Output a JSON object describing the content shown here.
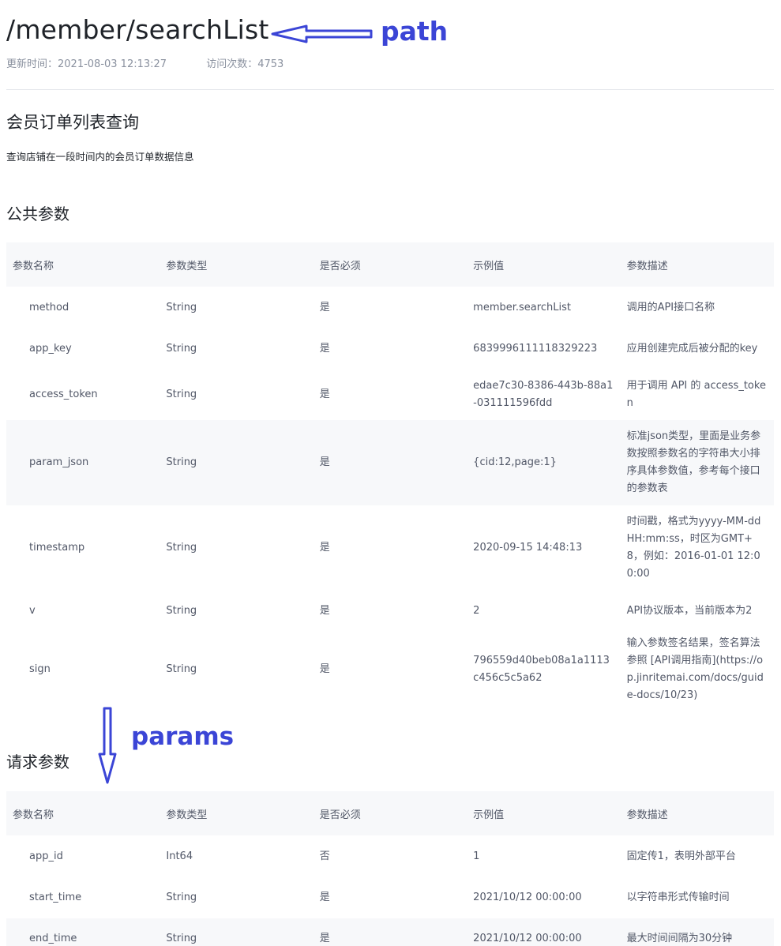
{
  "header": {
    "path": "/member/searchList",
    "updated_time": "更新时间：2021-08-03 12:13:27",
    "visit_count": "访问次数：4753"
  },
  "api": {
    "name": "会员订单列表查询",
    "description": "查询店铺在一段时间内的会员订单数据信息"
  },
  "annotations": {
    "path_label": "path",
    "params_label": "params",
    "color": "#3b45d6"
  },
  "columns": [
    "参数名称",
    "参数类型",
    "是否必须",
    "示例值",
    "参数描述"
  ],
  "public_params": {
    "title": "公共参数",
    "rows": [
      {
        "name": "method",
        "type": "String",
        "required": "是",
        "example": "member.searchList",
        "desc": "调用的API接口名称"
      },
      {
        "name": "app_key",
        "type": "String",
        "required": "是",
        "example": "6839996111118329223",
        "desc": "应用创建完成后被分配的key"
      },
      {
        "name": "access_token",
        "type": "String",
        "required": "是",
        "example": "edae7c30-8386-443b-88a1-031111596fdd",
        "desc": "用于调用 API 的 access_token"
      },
      {
        "name": "param_json",
        "type": "String",
        "required": "是",
        "example": "{cid:12,page:1}",
        "desc": "标准json类型，里面是业务参数按照参数名的字符串大小排序具体参数值，参考每个接口的参数表"
      },
      {
        "name": "timestamp",
        "type": "String",
        "required": "是",
        "example": "2020-09-15 14:48:13",
        "desc": "时间戳，格式为yyyy-MM-dd HH:mm:ss，时区为GMT+8，例如：2016-01-01 12:00:00"
      },
      {
        "name": "v",
        "type": "String",
        "required": "是",
        "example": "2",
        "desc": "API协议版本，当前版本为2"
      },
      {
        "name": "sign",
        "type": "String",
        "required": "是",
        "example": "796559d40beb08a1a1113c456c5c5a62",
        "desc": "输入参数签名结果，签名算法参照 [API调用指南](https://op.jinritemai.com/docs/guide-docs/10/23)"
      }
    ]
  },
  "request_params": {
    "title": "请求参数",
    "rows": [
      {
        "name": "app_id",
        "type": "Int64",
        "required": "否",
        "example": "1",
        "desc": "固定传1，表明外部平台"
      },
      {
        "name": "start_time",
        "type": "String",
        "required": "是",
        "example": "2021/10/12 00:00:00",
        "desc": "以字符串形式传输时间"
      },
      {
        "name": "end_time",
        "type": "String",
        "required": "是",
        "example": "2021/10/12 00:00:00",
        "desc": "最大时间间隔为30分钟"
      }
    ]
  }
}
